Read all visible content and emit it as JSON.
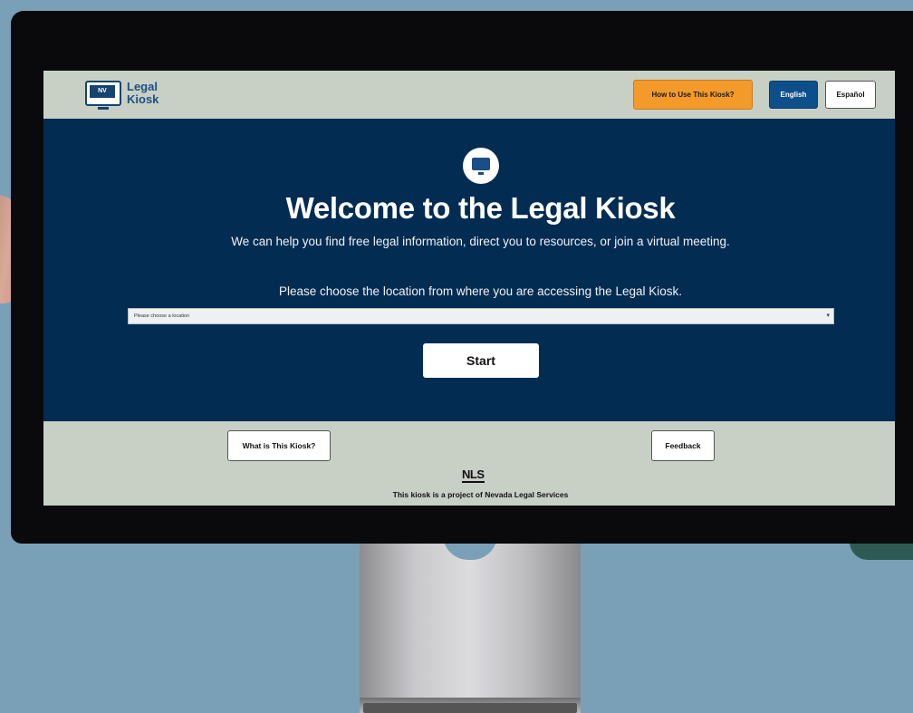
{
  "header": {
    "logo_badge": "NV",
    "logo_line1": "Legal",
    "logo_line2": "Kiosk",
    "howto_label": "How to Use This Kiosk?",
    "english_label": "English",
    "espanol_label": "Español"
  },
  "hero": {
    "title": "Welcome to the Legal Kiosk",
    "subtitle": "We can help you find free legal information, direct you to resources, or join a virtual meeting.",
    "location_prompt": "Please choose the location from where you are accessing the Legal Kiosk.",
    "location_select_value": "Please choose a location",
    "start_label": "Start"
  },
  "footer": {
    "what_label": "What is This Kiosk?",
    "feedback_label": "Feedback",
    "nls_logo": "NLS",
    "credit": "This kiosk is a project of Nevada Legal Services"
  },
  "colors": {
    "header_bg": "#c8d0c6",
    "hero_bg": "#032c52",
    "howto_orange": "#f39a2b",
    "english_blue": "#0d4f8b"
  }
}
